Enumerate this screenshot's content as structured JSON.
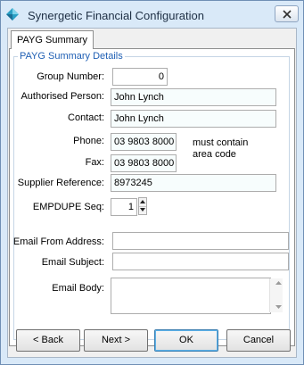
{
  "window": {
    "title": "Synergetic Financial Configuration"
  },
  "tabs": [
    {
      "label": "PAYG Summary",
      "active": true
    }
  ],
  "group": {
    "legend": "PAYG Summary Details"
  },
  "fields": {
    "group_number": {
      "label": "Group Number:",
      "value": "0"
    },
    "authorised_person": {
      "label": "Authorised Person:",
      "value": "John Lynch"
    },
    "contact": {
      "label": "Contact:",
      "value": "John Lynch"
    },
    "phone": {
      "label": "Phone:",
      "value": "03 9803 8000"
    },
    "fax": {
      "label": "Fax:",
      "value": "03 9803 8000"
    },
    "phone_note": "must contain area code",
    "supplier_reference": {
      "label": "Supplier Reference:",
      "value": "8973245"
    },
    "empdupe_seq": {
      "label": "EMPDUPE Seq:",
      "value": "1"
    },
    "email_from": {
      "label": "Email From Address:",
      "value": ""
    },
    "email_subject": {
      "label": "Email Subject:",
      "value": ""
    },
    "email_body": {
      "label": "Email Body:",
      "value": ""
    }
  },
  "buttons": {
    "back": "< Back",
    "next": "Next >",
    "ok": "OK",
    "cancel": "Cancel"
  },
  "colors": {
    "legend": "#1f5fb4",
    "accent": "#3c7fb1"
  },
  "icons": [
    "app-diamond-icon",
    "close-icon",
    "spin-up-icon",
    "spin-down-icon",
    "scroll-up-icon",
    "scroll-down-icon"
  ]
}
